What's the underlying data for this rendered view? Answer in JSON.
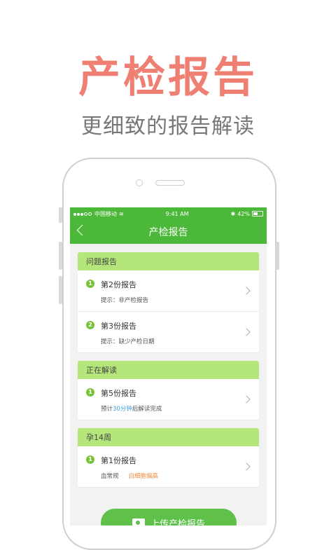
{
  "promo": {
    "headline": "产检报告",
    "subline": "更细致的报告解读"
  },
  "status_bar": {
    "carrier": "中国移动",
    "time": "9:41 AM",
    "battery": "42%"
  },
  "nav": {
    "title": "产检报告"
  },
  "sections": [
    {
      "header": "问题报告",
      "items": [
        {
          "num": "1",
          "title": "第2份报告",
          "sub": "提示：非产检报告"
        },
        {
          "num": "2",
          "title": "第3份报告",
          "sub": "提示：缺少产检日期"
        }
      ]
    },
    {
      "header": "正在解读",
      "items": [
        {
          "num": "1",
          "title": "第5份报告",
          "sub_prefix": "预计",
          "sub_highlight": "30分钟",
          "sub_suffix": "后解读完成"
        }
      ]
    },
    {
      "header": "孕14周",
      "items": [
        {
          "num": "1",
          "title": "第1份报告",
          "sub": "血常规",
          "sub_highlight": "白细胞偏高"
        }
      ]
    }
  ],
  "upload_button": "上传产检报告",
  "colors": {
    "accent_green": "#4cb83a",
    "section_green": "#b4e67c",
    "headline_red": "#ef7f72",
    "highlight_blue": "#3aa0e0",
    "highlight_orange": "#f08a3a"
  }
}
